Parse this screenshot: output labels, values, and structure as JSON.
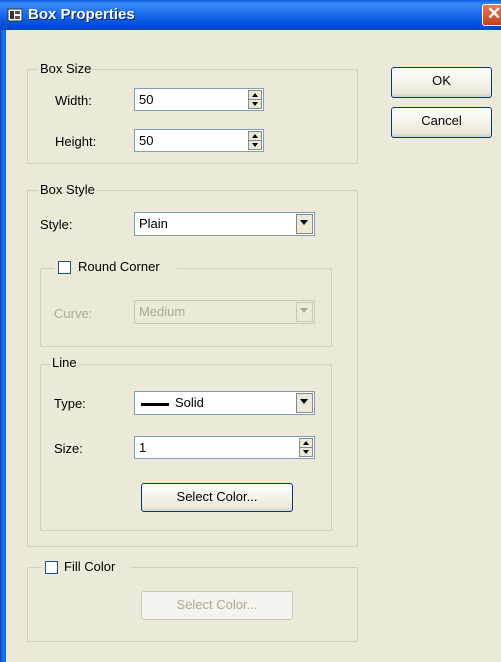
{
  "window": {
    "title": "Box Properties"
  },
  "buttons": {
    "ok": "OK",
    "cancel": "Cancel"
  },
  "box_size": {
    "legend": "Box Size",
    "width_label": "Width:",
    "width_value": "50",
    "height_label": "Height:",
    "height_value": "50"
  },
  "box_style": {
    "legend": "Box Style",
    "style_label": "Style:",
    "style_value": "Plain",
    "round_corner": {
      "label": "Round Corner",
      "checked": false,
      "curve_label": "Curve:",
      "curve_value": "Medium"
    },
    "line": {
      "legend": "Line",
      "type_label": "Type:",
      "type_value": "Solid",
      "size_label": "Size:",
      "size_value": "1",
      "select_color": "Select Color..."
    }
  },
  "fill_color": {
    "label": "Fill Color",
    "checked": false,
    "select_color": "Select Color..."
  }
}
